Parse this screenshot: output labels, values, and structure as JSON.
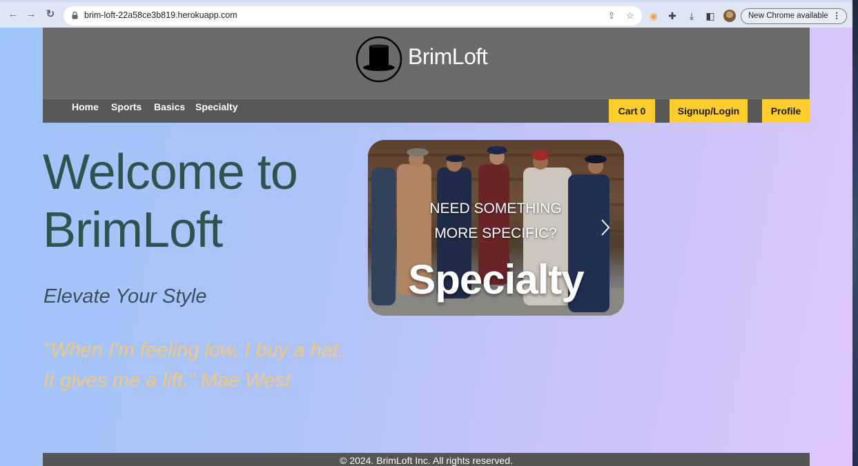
{
  "browser": {
    "url": "brim-loft-22a58ce3b819.herokuapp.com",
    "update_chip": "New Chrome available",
    "menu_glyph": "⋮"
  },
  "site": {
    "brand": "BrimLoft",
    "nav": {
      "links": [
        "Home",
        "Sports",
        "Basics",
        "Specialty"
      ],
      "cart_label": "Cart 0",
      "signup_label": "Signup/Login",
      "profile_label": "Profile"
    },
    "hero": {
      "title": "Welcome to BrimLoft",
      "tagline": "Elevate Your Style",
      "quote_line1": "\"When I'm feeling low, I buy a hat.",
      "quote_line2": "It gives me a lift.\" Mae West"
    },
    "carousel": {
      "caption_line1": "NEED SOMETHING",
      "caption_line2": "MORE SPECIFIC?",
      "title": "Specialty"
    },
    "footer": "© 2024. BrimLoft Inc. All rights reserved."
  },
  "colors": {
    "header_bg": "#6b6b6b",
    "nav_bg": "#575757",
    "accent_button": "#fccd2d",
    "hero_title": "#2f5450",
    "quote": "#f1c87d"
  },
  "icons": [
    "back-icon",
    "forward-icon",
    "reload-icon",
    "lock-icon",
    "share-icon",
    "star-icon",
    "extension-icon",
    "puzzle-icon",
    "download-icon",
    "sidepanel-icon",
    "top-hat-logo-icon",
    "chevron-right-icon"
  ]
}
